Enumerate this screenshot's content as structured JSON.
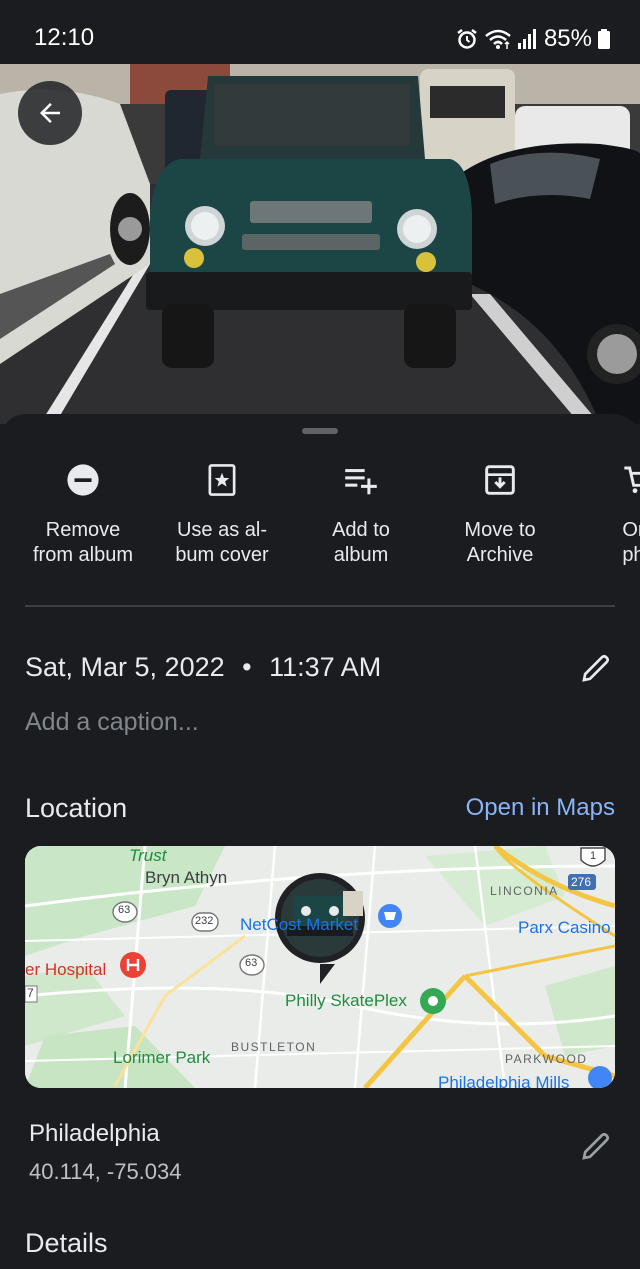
{
  "status_bar": {
    "time": "12:10",
    "battery": "85%",
    "icons": [
      "alarm-icon",
      "wifi-icon",
      "signal-icon",
      "battery-icon"
    ]
  },
  "photo": {
    "description_icon": "photo-image"
  },
  "actions": [
    {
      "label": "Remove\nfrom album",
      "icon": "remove-circle-icon"
    },
    {
      "label": "Use as al-\nbum cover",
      "icon": "album-cover-icon"
    },
    {
      "label": "Add to\nalbum",
      "icon": "playlist-add-icon"
    },
    {
      "label": "Move to\nArchive",
      "icon": "archive-icon"
    },
    {
      "label": "Ord\npho",
      "icon": "cart-icon"
    }
  ],
  "info": {
    "date": "Sat, Mar 5, 2022",
    "separator": "•",
    "time": "11:37 AM",
    "caption_placeholder": "Add a caption..."
  },
  "location": {
    "title": "Location",
    "open_maps": "Open in Maps",
    "place": "Philadelphia",
    "coords": "40.114, -75.034",
    "map_labels": {
      "trust": "Trust",
      "bryn_athyn": "Bryn Athyn",
      "linconia": "LINCONIA",
      "parx": "Parx Casino",
      "netcost": "NetCost Market",
      "hospital": "er Hospital",
      "skateplex": "Philly SkatePlex",
      "lorimer": "Lorimer Park",
      "bustleton": "BUSTLETON",
      "parkwood": "PARKWOOD",
      "philadelphia_mills": "Philadelphia Mills",
      "r63a": "63",
      "r232": "232",
      "r63b": "63",
      "r1": "1",
      "r276": "276",
      "r7": "7"
    }
  },
  "details": {
    "title": "Details"
  },
  "colors": {
    "background": "#1b1c1f",
    "accent": "#8ab4f8"
  }
}
